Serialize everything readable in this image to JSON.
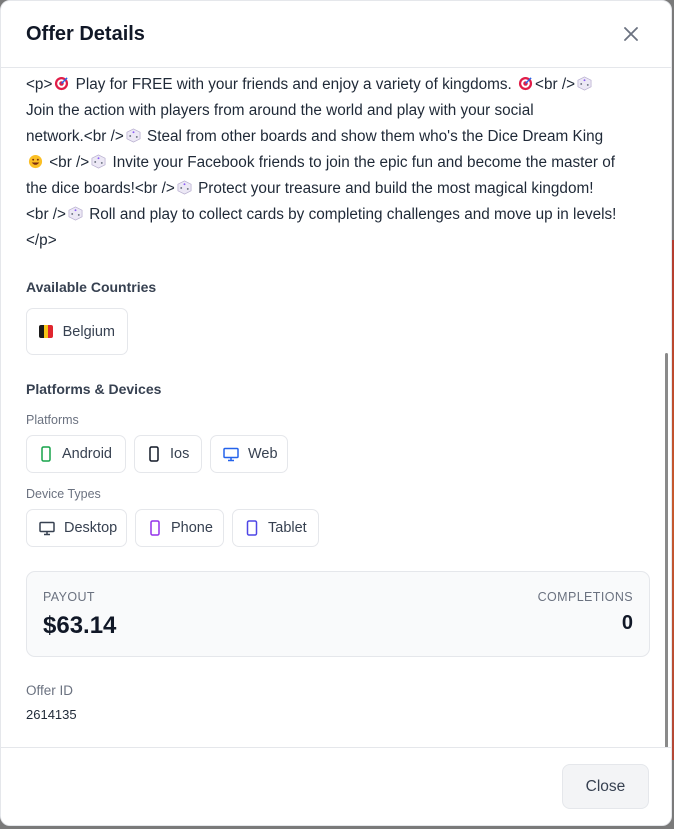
{
  "modal": {
    "title": "Offer Details",
    "close_label": "Close"
  },
  "description": {
    "lines": [
      [
        "<p>",
        "target",
        " Play for FREE with your friends and enjoy a variety of kingdoms. ",
        "target",
        "<br />",
        "dice"
      ],
      [
        "Join the action with players from around the world and play with your social"
      ],
      [
        "network.<br />",
        "dice",
        " Steal from other boards and show them who's the Dice Dream King"
      ],
      [
        "grin",
        " <br />",
        "dice",
        " Invite your Facebook friends to join the epic fun and become the master of"
      ],
      [
        "the dice boards!<br />",
        "dice",
        " Protect your treasure and build the most magical kingdom!"
      ],
      [
        "<br />",
        "dice",
        " Roll and play to collect cards by completing challenges and move up in levels!"
      ],
      [
        "</p>"
      ]
    ]
  },
  "countries": {
    "title": "Available Countries",
    "items": [
      {
        "label": "Belgium",
        "flag_colors": [
          "#1a1a1a",
          "#f5c518",
          "#e0262e"
        ]
      }
    ]
  },
  "platforms_devices": {
    "title": "Platforms & Devices",
    "platforms_label": "Platforms",
    "platforms": [
      {
        "label": "Android",
        "icon": "smartphone-icon",
        "color": "#16a34a"
      },
      {
        "label": "Ios",
        "icon": "smartphone-icon",
        "color": "#111827"
      },
      {
        "label": "Web",
        "icon": "monitor-icon",
        "color": "#2563eb"
      }
    ],
    "device_types_label": "Device Types",
    "device_types": [
      {
        "label": "Desktop",
        "icon": "monitor-icon",
        "color": "#374151"
      },
      {
        "label": "Phone",
        "icon": "smartphone-icon",
        "color": "#9333ea"
      },
      {
        "label": "Tablet",
        "icon": "tablet-icon",
        "color": "#4f46e5"
      }
    ]
  },
  "stats": {
    "payout_label": "PAYOUT",
    "payout_value": "$63.14",
    "completions_label": "COMPLETIONS",
    "completions_value": "0"
  },
  "offer": {
    "id_label": "Offer ID",
    "id_value": "2614135"
  }
}
